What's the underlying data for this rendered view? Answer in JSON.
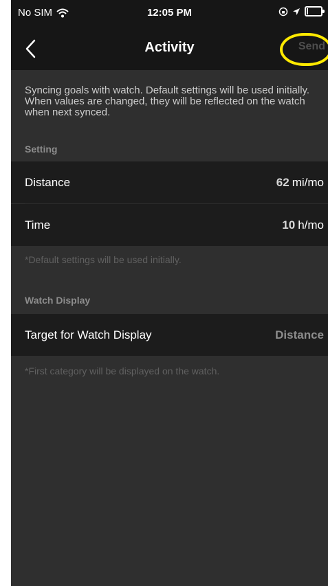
{
  "status": {
    "carrier": "No SIM",
    "time": "12:05 PM"
  },
  "nav": {
    "title": "Activity",
    "send_label": "Send"
  },
  "info_text": "Syncing goals with watch. Default settings will be used initially. When values are changed, they will be reflected on the watch when next synced.",
  "setting": {
    "header": "Setting",
    "distance": {
      "label": "Distance",
      "value": "62",
      "unit": "mi/mo"
    },
    "time": {
      "label": "Time",
      "value": "10",
      "unit": "h/mo"
    },
    "note": "*Default settings will be used initially."
  },
  "watch_display": {
    "header": "Watch Display",
    "target": {
      "label": "Target for Watch Display",
      "value": "Distance"
    },
    "note": "*First category will be displayed on the watch."
  },
  "colors": {
    "accent_highlight": "#ffea00",
    "row_bg": "#1c1c1c",
    "page_bg": "#2f2f2f"
  }
}
